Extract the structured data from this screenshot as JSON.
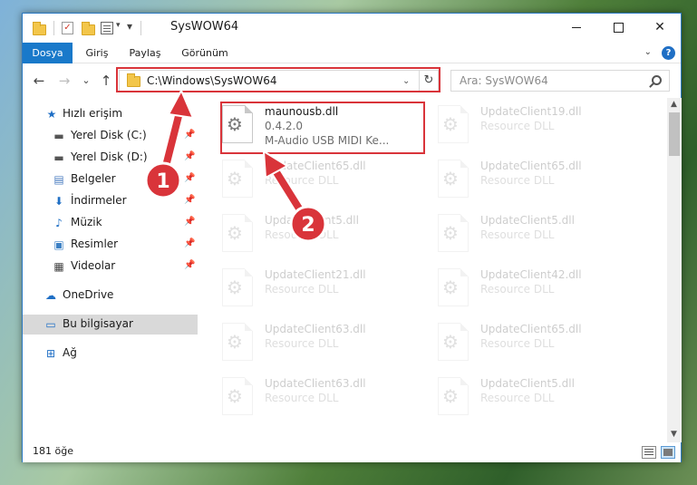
{
  "window": {
    "title": "SysWOW64",
    "close_glyph": "✕"
  },
  "ribbon": {
    "tabs": [
      {
        "label": "Dosya"
      },
      {
        "label": "Giriş"
      },
      {
        "label": "Paylaş"
      },
      {
        "label": "Görünüm"
      }
    ],
    "help_glyph": "?"
  },
  "navigation": {
    "back_glyph": "←",
    "forward_glyph": "→",
    "recent_glyph": "⌄",
    "up_glyph": "↑",
    "address_path": "C:\\Windows\\SysWOW64",
    "refresh_glyph": "↻",
    "search_placeholder": "Ara: SysWOW64"
  },
  "sidebar": {
    "items": [
      {
        "label": "Hızlı erişim",
        "icon": "star-icon",
        "glyph": "★",
        "color": "#1f6fc5"
      },
      {
        "label": "Yerel Disk (C:)",
        "icon": "drive-icon",
        "glyph": "▬",
        "color": "#555555",
        "pinned": true
      },
      {
        "label": "Yerel Disk (D:)",
        "icon": "drive-icon",
        "glyph": "▬",
        "color": "#555555",
        "pinned": true
      },
      {
        "label": "Belgeler",
        "icon": "documents-icon",
        "glyph": "▤",
        "color": "#4a7cc0",
        "pinned": true
      },
      {
        "label": "İndirmeler",
        "icon": "download-icon",
        "glyph": "⬇",
        "color": "#1f6fc5",
        "pinned": true
      },
      {
        "label": "Müzik",
        "icon": "music-icon",
        "glyph": "♪",
        "color": "#1f6fc5",
        "pinned": true
      },
      {
        "label": "Resimler",
        "icon": "pictures-icon",
        "glyph": "▣",
        "color": "#3b7fc4",
        "pinned": true
      },
      {
        "label": "Videolar",
        "icon": "video-icon",
        "glyph": "▦",
        "color": "#444444",
        "pinned": true
      },
      {
        "label": "OneDrive",
        "icon": "cloud-icon",
        "glyph": "☁",
        "color": "#1f6fc5"
      },
      {
        "label": "Bu bilgisayar",
        "icon": "computer-icon",
        "glyph": "▭",
        "color": "#1f6fc5",
        "selected": true
      },
      {
        "label": "Ağ",
        "icon": "network-icon",
        "glyph": "⊞",
        "color": "#1f6fc5"
      }
    ],
    "pin_glyph": "📌"
  },
  "files": {
    "selected": {
      "name": "maunousb.dll",
      "version": "0.4.2.0",
      "description": "M-Audio USB MIDI Ke..."
    },
    "background": [
      {
        "name": "UpdateClient19.dll",
        "type": "Resource DLL"
      },
      {
        "name": "UpdateClient65.dll",
        "type": "Resource DLL"
      },
      {
        "name": "UpdateClient65.dll",
        "type": "Resource DLL"
      },
      {
        "name": "UpdateClient5.dll",
        "type": "Resource DLL"
      },
      {
        "name": "UpdateClient5.dll",
        "type": "Resource DLL"
      },
      {
        "name": "UpdateClient21.dll",
        "type": "Resource DLL"
      },
      {
        "name": "UpdateClient42.dll",
        "type": "Resource DLL"
      },
      {
        "name": "UpdateClient63.dll",
        "type": "Resource DLL"
      },
      {
        "name": "UpdateClient65.dll",
        "type": "Resource DLL"
      },
      {
        "name": "UpdateClient63.dll",
        "type": "Resource DLL"
      },
      {
        "name": "UpdateClient5.dll",
        "type": "Resource DLL"
      }
    ]
  },
  "status": {
    "item_count": "181 öğe"
  },
  "annotations": [
    {
      "number": "1",
      "color": "#d9343a"
    },
    {
      "number": "2",
      "color": "#d9343a"
    }
  ],
  "colors": {
    "accent": "#1979ca",
    "highlight_red": "#d9343a",
    "selected_sidebar": "#d9d9d9"
  }
}
